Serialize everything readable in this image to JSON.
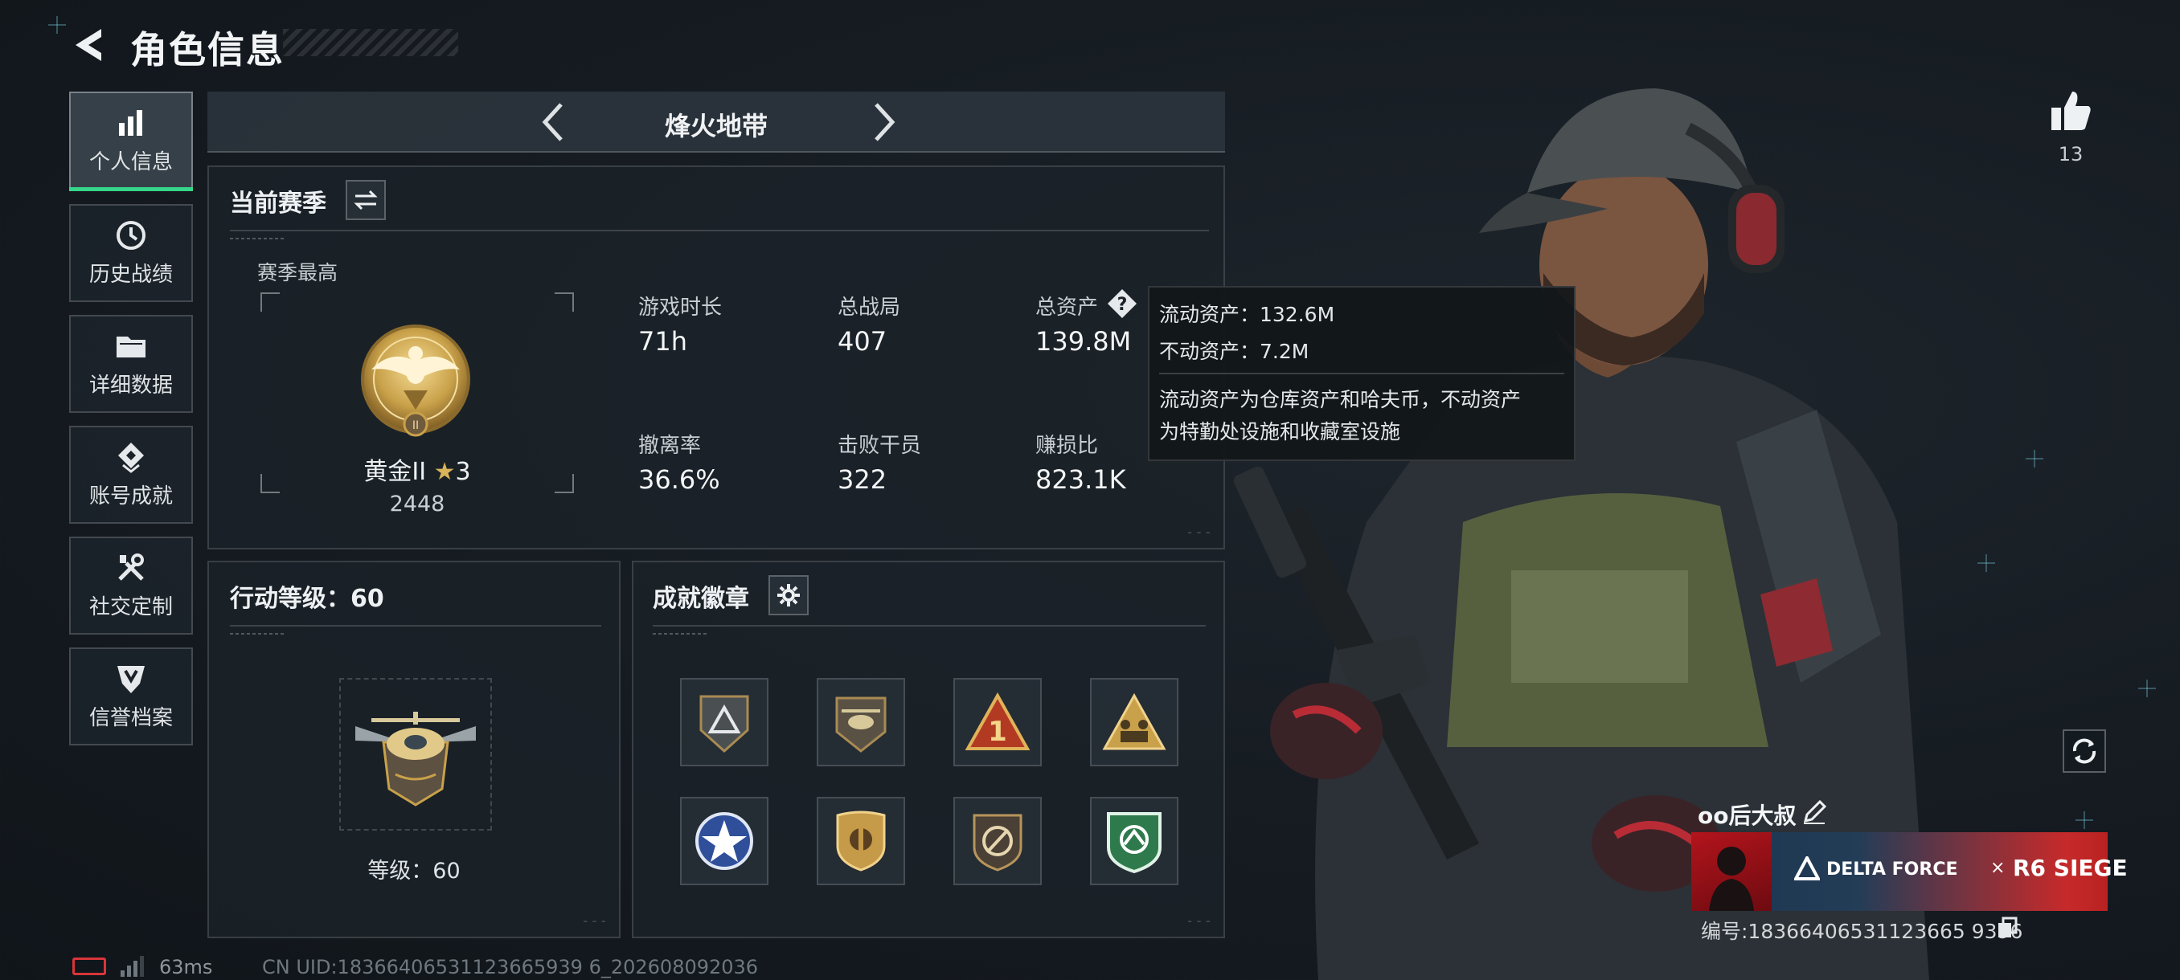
{
  "header": {
    "title": "角色信息"
  },
  "sidebar": {
    "items": [
      {
        "label": "个人信息",
        "icon": "bar-chart-icon",
        "active": true
      },
      {
        "label": "历史战绩",
        "icon": "clock-icon"
      },
      {
        "label": "详细数据",
        "icon": "folder-icon"
      },
      {
        "label": "账号成就",
        "icon": "achievement-icon"
      },
      {
        "label": "社交定制",
        "icon": "tools-icon"
      },
      {
        "label": "信誉档案",
        "icon": "shield-icon"
      }
    ]
  },
  "mode_selector": {
    "name": "烽火地带"
  },
  "season": {
    "title": "当前赛季",
    "best_label": "赛季最高",
    "rank_name": "黄金II",
    "rank_stars": "3",
    "rank_score": "2448",
    "stats": [
      {
        "label": "游戏时长",
        "value": "71h"
      },
      {
        "label": "总战局",
        "value": "407"
      },
      {
        "label": "总资产",
        "value": "139.8M"
      },
      {
        "label": "撤离率",
        "value": "36.6%"
      },
      {
        "label": "击败干员",
        "value": "322"
      },
      {
        "label": "赚损比",
        "value": "823.1K"
      }
    ]
  },
  "tooltip": {
    "liquid": "流动资产：132.6M",
    "fixed": "不动资产：7.2M",
    "desc_line1": "流动资产为仓库资产和哈夫币，不动资产",
    "desc_line2": "为特勤处设施和收藏室设施"
  },
  "action_level": {
    "title": "行动等级：60",
    "level_text": "等级：60"
  },
  "achievements": {
    "title": "成就徽章"
  },
  "profile": {
    "likes": "13",
    "player_name": "oo后大叔",
    "card_brand": "DELTA FORCE",
    "card_cross": "×",
    "card_brand2": "R6 SIEGE",
    "uid_line": "编号:18366406531123665 9396"
  },
  "footer": {
    "ping": "63ms",
    "cn_uid": "CN UID:18366406531123665939 6_202608092036"
  },
  "colors": {
    "accent_green": "#36d68a",
    "battery_red": "#d8353a",
    "gold": "#c9a14a"
  }
}
